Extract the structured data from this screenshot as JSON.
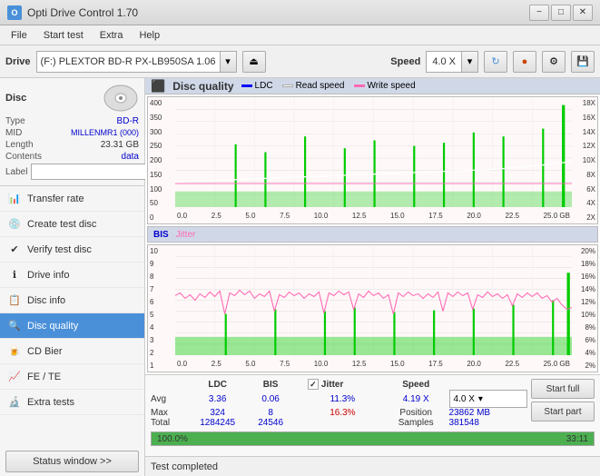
{
  "titlebar": {
    "title": "Opti Drive Control 1.70",
    "icon": "O",
    "minimize": "−",
    "maximize": "□",
    "close": "✕"
  },
  "menubar": {
    "items": [
      "File",
      "Start test",
      "Extra",
      "Help"
    ]
  },
  "toolbar": {
    "drive_label": "Drive",
    "drive_value": "(F:)  PLEXTOR BD-R   PX-LB950SA 1.06",
    "speed_label": "Speed",
    "speed_value": "4.0 X"
  },
  "disc": {
    "title": "Disc",
    "type_label": "Type",
    "type_value": "BD-R",
    "mid_label": "MID",
    "mid_value": "MILLENMR1 (000)",
    "length_label": "Length",
    "length_value": "23.31 GB",
    "contents_label": "Contents",
    "contents_value": "data",
    "label_label": "Label"
  },
  "nav": {
    "items": [
      {
        "id": "transfer-rate",
        "label": "Transfer rate",
        "icon": "📊"
      },
      {
        "id": "create-test-disc",
        "label": "Create test disc",
        "icon": "💿"
      },
      {
        "id": "verify-test-disc",
        "label": "Verify test disc",
        "icon": "✔"
      },
      {
        "id": "drive-info",
        "label": "Drive info",
        "icon": "ℹ"
      },
      {
        "id": "disc-info",
        "label": "Disc info",
        "icon": "📋"
      },
      {
        "id": "disc-quality",
        "label": "Disc quality",
        "icon": "🔍",
        "active": true
      },
      {
        "id": "cd-bier",
        "label": "CD Bier",
        "icon": "🍺"
      },
      {
        "id": "fe-te",
        "label": "FE / TE",
        "icon": "📈"
      },
      {
        "id": "extra-tests",
        "label": "Extra tests",
        "icon": "🔬"
      }
    ],
    "status_btn": "Status window >>"
  },
  "quality_chart": {
    "title": "Disc quality",
    "legend": {
      "ldc": "LDC",
      "read_speed": "Read speed",
      "write_speed": "Write speed"
    },
    "top_chart": {
      "y_labels_left": [
        "400",
        "350",
        "300",
        "250",
        "200",
        "150",
        "100",
        "50",
        "0"
      ],
      "y_labels_right": [
        "18X",
        "16X",
        "14X",
        "12X",
        "10X",
        "8X",
        "6X",
        "4X",
        "2X"
      ],
      "x_labels": [
        "0.0",
        "2.5",
        "5.0",
        "7.5",
        "10.0",
        "12.5",
        "15.0",
        "17.5",
        "20.0",
        "22.5",
        "25.0 GB"
      ]
    },
    "bottom_chart": {
      "title_bis": "BIS",
      "title_jitter": "Jitter",
      "y_labels_left": [
        "10",
        "9",
        "8",
        "7",
        "6",
        "5",
        "4",
        "3",
        "2",
        "1"
      ],
      "y_labels_right": [
        "20%",
        "18%",
        "16%",
        "14%",
        "12%",
        "10%",
        "8%",
        "6%",
        "4%",
        "2%"
      ],
      "x_labels": [
        "0.0",
        "2.5",
        "5.0",
        "7.5",
        "10.0",
        "12.5",
        "15.0",
        "17.5",
        "20.0",
        "22.5",
        "25.0 GB"
      ]
    }
  },
  "stats": {
    "headers": [
      "LDC",
      "BIS",
      "",
      "Jitter",
      "Speed"
    ],
    "avg_label": "Avg",
    "avg_ldc": "3.36",
    "avg_bis": "0.06",
    "avg_jitter": "11.3%",
    "avg_speed": "4.19 X",
    "speed_select": "4.0 X",
    "max_label": "Max",
    "max_ldc": "324",
    "max_bis": "8",
    "max_jitter": "16.3%",
    "position_label": "Position",
    "position_value": "23862 MB",
    "total_label": "Total",
    "total_ldc": "1284245",
    "total_bis": "24546",
    "samples_label": "Samples",
    "samples_value": "381548",
    "jitter_checked": true,
    "start_full": "Start full",
    "start_part": "Start part"
  },
  "progress": {
    "percent": "100.0%",
    "fill_width": "100%",
    "time": "33:11"
  },
  "statusbar": {
    "text": "Test completed"
  }
}
